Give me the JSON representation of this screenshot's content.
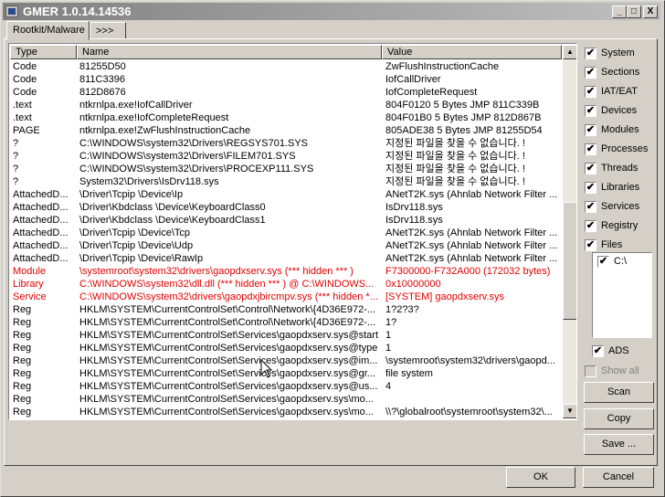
{
  "title": "GMER 1.0.14.14536",
  "window_controls": {
    "minimize": "_",
    "maximize": "□",
    "close": "X"
  },
  "tabs": [
    {
      "label": "Rootkit/Malware"
    },
    {
      "label": ">>>"
    }
  ],
  "table": {
    "headers": [
      "Type",
      "Name",
      "Value"
    ],
    "rows": [
      {
        "type": "Code",
        "name": "81255D50",
        "value": "ZwFlushInstructionCache",
        "red": false
      },
      {
        "type": "Code",
        "name": "811C3396",
        "value": "IofCallDriver",
        "red": false
      },
      {
        "type": "Code",
        "name": "812D8676",
        "value": "IofCompleteRequest",
        "red": false
      },
      {
        "type": ".text",
        "name": "ntkrnlpa.exe!IofCallDriver",
        "value": "804F0120 5 Bytes  JMP 811C339B",
        "red": false
      },
      {
        "type": ".text",
        "name": "ntkrnlpa.exe!IofCompleteRequest",
        "value": "804F01B0 5 Bytes  JMP 812D867B",
        "red": false
      },
      {
        "type": "PAGE",
        "name": "ntkrnlpa.exe!ZwFlushInstructionCache",
        "value": "805ADE38 5 Bytes  JMP 81255D54",
        "red": false
      },
      {
        "type": "?",
        "name": "C:\\WINDOWS\\system32\\Drivers\\REGSYS701.SYS",
        "value": "지정된 파일을 찾을 수 없습니다. !",
        "red": false
      },
      {
        "type": "?",
        "name": "C:\\WINDOWS\\system32\\Drivers\\FILEM701.SYS",
        "value": "지정된 파일을 찾을 수 없습니다. !",
        "red": false
      },
      {
        "type": "?",
        "name": "C:\\WINDOWS\\system32\\Drivers\\PROCEXP111.SYS",
        "value": "지정된 파일을 찾을 수 없습니다. !",
        "red": false
      },
      {
        "type": "?",
        "name": "System32\\Drivers\\IsDrv118.sys",
        "value": "지정된 파일을 찾을 수 없습니다. !",
        "red": false
      },
      {
        "type": "AttachedD...",
        "name": "\\Driver\\Tcpip \\Device\\Ip",
        "value": "ANetT2K.sys (Ahnlab Network Filter ...",
        "red": false
      },
      {
        "type": "AttachedD...",
        "name": "\\Driver\\Kbdclass \\Device\\KeyboardClass0",
        "value": "IsDrv118.sys",
        "red": false
      },
      {
        "type": "AttachedD...",
        "name": "\\Driver\\Kbdclass \\Device\\KeyboardClass1",
        "value": "IsDrv118.sys",
        "red": false
      },
      {
        "type": "AttachedD...",
        "name": "\\Driver\\Tcpip \\Device\\Tcp",
        "value": "ANetT2K.sys (Ahnlab Network Filter ...",
        "red": false
      },
      {
        "type": "AttachedD...",
        "name": "\\Driver\\Tcpip \\Device\\Udp",
        "value": "ANetT2K.sys (Ahnlab Network Filter ...",
        "red": false
      },
      {
        "type": "AttachedD...",
        "name": "\\Driver\\Tcpip \\Device\\RawIp",
        "value": "ANetT2K.sys (Ahnlab Network Filter ...",
        "red": false
      },
      {
        "type": "Module",
        "name": "\\systemroot\\system32\\drivers\\gaopdxserv.sys (*** hidden *** )",
        "value": "F7300000-F732A000 (172032 bytes)",
        "red": true
      },
      {
        "type": "Library",
        "name": "C:\\WINDOWS\\system32\\dll.dll (*** hidden *** ) @ C:\\WINDOWS...",
        "value": "0x10000000",
        "red": true
      },
      {
        "type": "Service",
        "name": "C:\\WINDOWS\\system32\\drivers\\gaopdxjbircmpv.sys (*** hidden *...",
        "value": "[SYSTEM] gaopdxserv.sys",
        "red": true
      },
      {
        "type": "Reg",
        "name": "HKLM\\SYSTEM\\CurrentControlSet\\Control\\Network\\{4D36E972-...",
        "value": "1?2?3?",
        "red": false
      },
      {
        "type": "Reg",
        "name": "HKLM\\SYSTEM\\CurrentControlSet\\Control\\Network\\{4D36E972-...",
        "value": "1?",
        "red": false
      },
      {
        "type": "Reg",
        "name": "HKLM\\SYSTEM\\CurrentControlSet\\Services\\gaopdxserv.sys@start",
        "value": "1",
        "red": false
      },
      {
        "type": "Reg",
        "name": "HKLM\\SYSTEM\\CurrentControlSet\\Services\\gaopdxserv.sys@type",
        "value": "1",
        "red": false
      },
      {
        "type": "Reg",
        "name": "HKLM\\SYSTEM\\CurrentControlSet\\Services\\gaopdxserv.sys@im...",
        "value": "\\systemroot\\system32\\drivers\\gaopd...",
        "red": false
      },
      {
        "type": "Reg",
        "name": "HKLM\\SYSTEM\\CurrentControlSet\\Services\\gaopdxserv.sys@gr...",
        "value": "file system",
        "red": false
      },
      {
        "type": "Reg",
        "name": "HKLM\\SYSTEM\\CurrentControlSet\\Services\\gaopdxserv.sys@us...",
        "value": "4",
        "red": false
      },
      {
        "type": "Reg",
        "name": "HKLM\\SYSTEM\\CurrentControlSet\\Services\\gaopdxserv.sys\\mo...",
        "value": "",
        "red": false
      },
      {
        "type": "Reg",
        "name": "HKLM\\SYSTEM\\CurrentControlSet\\Services\\gaopdxserv.sys\\mo...",
        "value": "\\\\?\\globalroot\\systemroot\\system32\\...",
        "red": false
      }
    ]
  },
  "scroll_position": 0.63,
  "options": [
    {
      "label": "System",
      "checked": true
    },
    {
      "label": "Sections",
      "checked": true
    },
    {
      "label": "IAT/EAT",
      "checked": true
    },
    {
      "label": "Devices",
      "checked": true
    },
    {
      "label": "Modules",
      "checked": true
    },
    {
      "label": "Processes",
      "checked": true
    },
    {
      "label": "Threads",
      "checked": true
    },
    {
      "label": "Libraries",
      "checked": true
    },
    {
      "label": "Services",
      "checked": true
    },
    {
      "label": "Registry",
      "checked": true
    },
    {
      "label": "Files",
      "checked": true
    }
  ],
  "drives": [
    {
      "label": "C:\\",
      "checked": true
    }
  ],
  "ads": {
    "label": "ADS",
    "checked": true
  },
  "show_all": {
    "label": "Show all",
    "checked": false
  },
  "buttons": {
    "scan": "Scan",
    "copy": "Copy",
    "save": "Save ...",
    "ok": "OK",
    "cancel": "Cancel"
  },
  "colors": {
    "alert": "#e00000",
    "face": "#d4d0c8"
  }
}
